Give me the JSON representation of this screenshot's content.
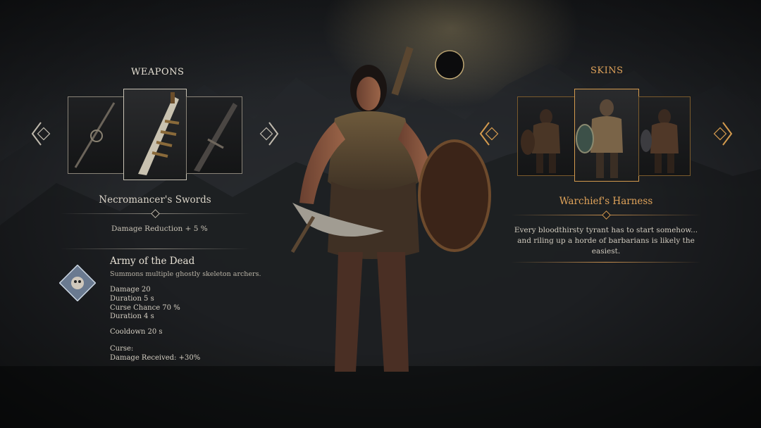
{
  "weapons": {
    "title": "WEAPONS",
    "selected_name": "Necromancer's Swords",
    "stat": "Damage Reduction + 5 %",
    "items": [
      "staff-weapon",
      "necromancer-sword",
      "dark-sword"
    ]
  },
  "ability": {
    "name": "Army of the Dead",
    "description": "Summons multiple ghostly skeleton archers.",
    "stats": [
      "Damage 20",
      "Duration 5 s",
      "Curse Chance 70 %",
      "Duration 4 s"
    ],
    "cooldown": "Cooldown 20 s",
    "curse": [
      "Curse:",
      "Damage Received: +30%"
    ]
  },
  "skins": {
    "title": "SKINS",
    "selected_name": "Warchief's Harness",
    "description": "Every bloodthirsty tyrant has to start somehow... and riling up a horde of barbarians is likely the easiest.",
    "items": [
      "skin-left",
      "skin-selected",
      "skin-right"
    ]
  },
  "colors": {
    "accent_gold": "#d39a4e",
    "text_light": "#e6e0d4"
  }
}
